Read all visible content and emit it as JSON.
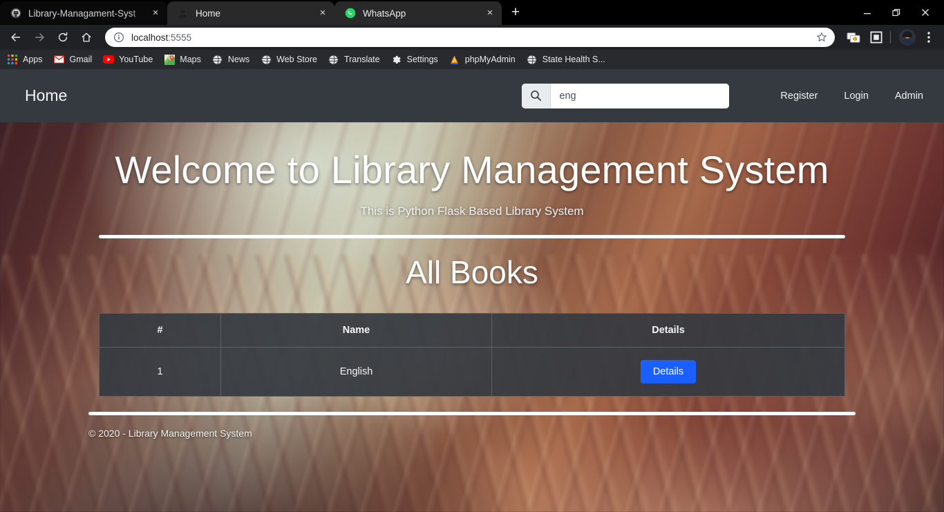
{
  "browser": {
    "tabs": [
      {
        "title": "Library-Managament-Syst",
        "favicon": "github-icon",
        "active": false,
        "close_label": "×"
      },
      {
        "title": "Home",
        "favicon": "user-silhouette-icon",
        "active": true,
        "close_label": "×"
      },
      {
        "title": "WhatsApp",
        "favicon": "whatsapp-icon",
        "active": true,
        "close_label": "×"
      }
    ],
    "new_tab_label": "+",
    "window_controls": {
      "minimize": "—",
      "restore": "❐",
      "close": "✕"
    },
    "toolbar": {
      "back_icon": "arrow-back-icon",
      "forward_icon": "arrow-forward-icon",
      "reload_icon": "reload-icon",
      "home_icon": "home-icon",
      "site_info_icon": "info-circle-icon",
      "url_host": "localhost",
      "url_port": ":5555",
      "bookmark_icon": "star-icon",
      "extension_icon": "chrome-webstore-icon",
      "cast_icon": "picture-in-picture-icon",
      "profile_icon": "avatar",
      "menu_icon": "three-dot-menu-icon"
    },
    "bookmarks": [
      {
        "label": "Apps",
        "icon": "apps-grid-icon"
      },
      {
        "label": "Gmail",
        "icon": "gmail-icon"
      },
      {
        "label": "YouTube",
        "icon": "youtube-icon"
      },
      {
        "label": "Maps",
        "icon": "google-maps-icon"
      },
      {
        "label": "News",
        "icon": "globe-icon"
      },
      {
        "label": "Web Store",
        "icon": "globe-icon"
      },
      {
        "label": "Translate",
        "icon": "globe-icon"
      },
      {
        "label": "Settings",
        "icon": "gear-icon"
      },
      {
        "label": "phpMyAdmin",
        "icon": "phpmyadmin-icon"
      },
      {
        "label": "State Health S...",
        "icon": "globe-icon"
      }
    ]
  },
  "site": {
    "navbar": {
      "brand": "Home",
      "search": {
        "value": "eng",
        "placeholder": "",
        "icon": "search-icon"
      },
      "links": [
        {
          "label": "Register"
        },
        {
          "label": "Login"
        },
        {
          "label": "Admin"
        }
      ]
    },
    "hero": {
      "title": "Welcome to Library Management System",
      "subtitle": "This is Python Flask Based Library System"
    },
    "books_section": {
      "heading": "All Books",
      "columns": [
        "#",
        "Name",
        "Details"
      ],
      "rows": [
        {
          "index": "1",
          "name": "English",
          "action_label": "Details"
        }
      ]
    },
    "footer": {
      "copyright": "© 2020 - Library Management System"
    },
    "colors": {
      "navbar_bg": "#343a40",
      "table_bg": "#343a40",
      "details_button": "#1a5fff",
      "text_light": "#ffffff"
    }
  }
}
